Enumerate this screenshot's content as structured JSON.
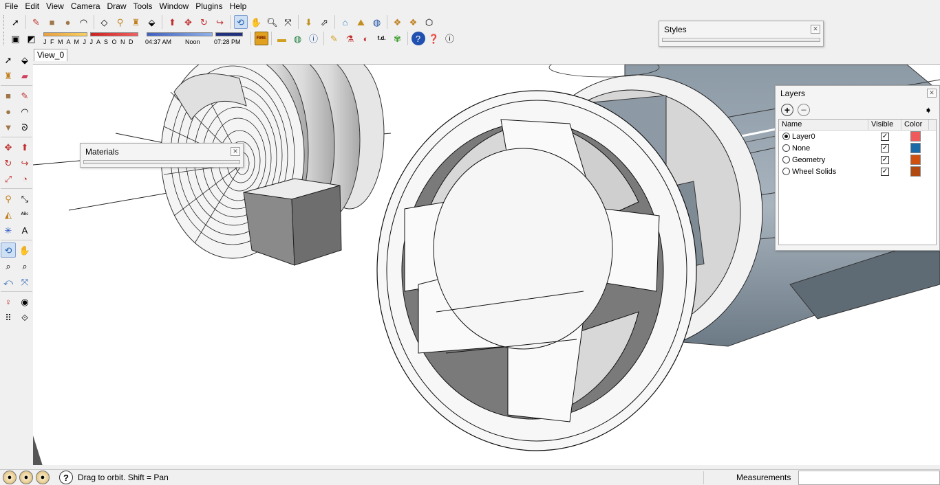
{
  "menu": [
    "File",
    "Edit",
    "View",
    "Camera",
    "Draw",
    "Tools",
    "Window",
    "Plugins",
    "Help"
  ],
  "shadows": {
    "months": "J F M A M J J A S O N D",
    "time_start": "04:37 AM",
    "time_mid": "Noon",
    "time_end": "07:28 PM"
  },
  "toolbar_icons": {
    "fire": "FIRE",
    "fd": "f.d."
  },
  "view_tab": "View_0",
  "styles_tray": {
    "title": "Styles"
  },
  "materials_tray": {
    "title": "Materials"
  },
  "layers_tray": {
    "title": "Layers",
    "columns": {
      "name": "Name",
      "visible": "Visible",
      "color": "Color"
    },
    "rows": [
      {
        "name": "Layer0",
        "active": true,
        "visible": true,
        "color": "#f05a5a"
      },
      {
        "name": "None",
        "active": false,
        "visible": true,
        "color": "#1a6aa8"
      },
      {
        "name": "Geometry",
        "active": false,
        "visible": true,
        "color": "#d05010"
      },
      {
        "name": "Wheel Solids",
        "active": false,
        "visible": true,
        "color": "#b04a10"
      }
    ]
  },
  "status": {
    "message": "Drag to orbit.  Shift = Pan",
    "measurements_label": "Measurements",
    "measurements_value": ""
  }
}
